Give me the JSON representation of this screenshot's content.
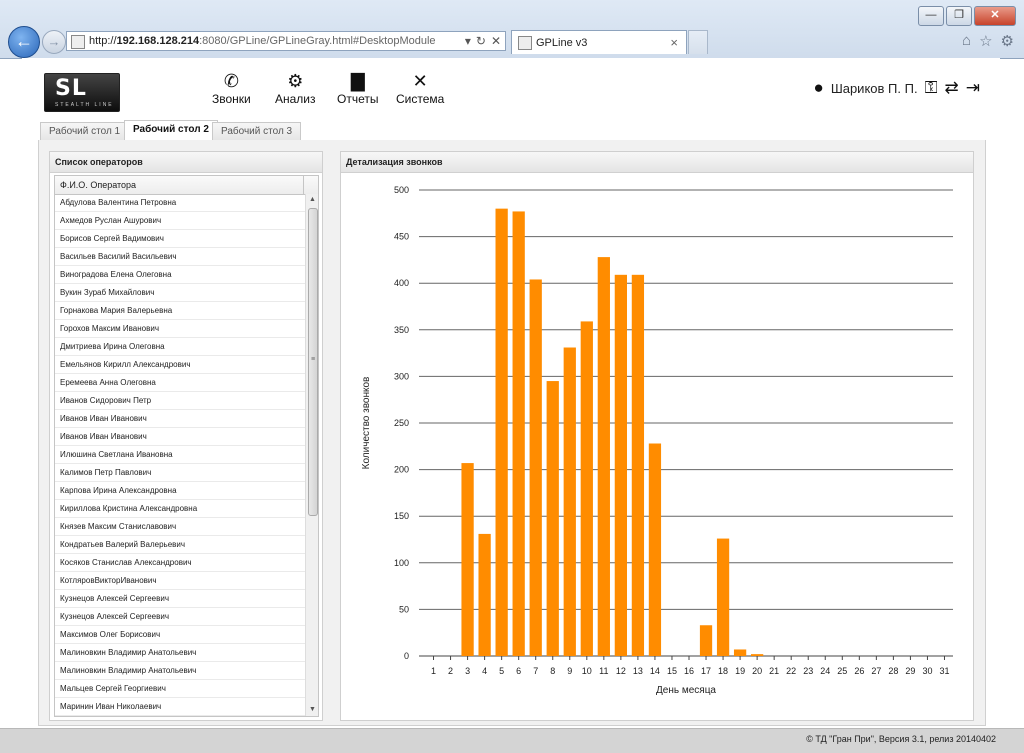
{
  "browser": {
    "url_prefix": "http://",
    "url_host": "192.168.128.214",
    "url_rest": ":8080/GPLine/GPLineGray.html#DesktopModule",
    "tab_title": "GPLine v3",
    "tab_close": "×",
    "back_glyph": "←",
    "forward_glyph": "→",
    "addr_icons": [
      "▾",
      "↻",
      "✕"
    ],
    "win_buttons": [
      "—",
      "❐",
      "✕"
    ],
    "toolbar_icons": [
      "⌂",
      "☆",
      "⚙"
    ]
  },
  "logo": {
    "mark": "SL",
    "sub": "STEALTH LINE"
  },
  "nav": [
    {
      "label": "Звонки",
      "icon": "phone-icon",
      "glyph": "✆"
    },
    {
      "label": "Анализ",
      "icon": "gears-icon",
      "glyph": "⚙"
    },
    {
      "label": "Отчеты",
      "icon": "bar-chart-icon",
      "glyph": "▇"
    },
    {
      "label": "Система",
      "icon": "tools-icon",
      "glyph": "✕"
    }
  ],
  "user": {
    "name": "Шариков П. П.",
    "user_glyph": "●",
    "key_glyph": "⚿",
    "swap_glyph": "⇄",
    "exit_glyph": "⇥"
  },
  "tabs": [
    "Рабочий стол 1",
    "Рабочий стол 2",
    "Рабочий стол 3"
  ],
  "active_tab_index": 1,
  "operators_panel": {
    "title": "Список операторов",
    "column_header": "Ф.И.О. Оператора",
    "grip": "≡",
    "up": "▲",
    "down": "▼",
    "rows": [
      "Абдулова Валентина Петровна",
      "Ахмедов Руслан Ашурович",
      "Борисов Сергей Вадимович",
      "Васильев Василий Васильевич",
      "Виноградова Елена Олеговна",
      "Вукин Зураб Михайлович",
      "Горнакова Мария Валерьевна",
      "Горохов Максим Иванович",
      "Дмитриева Ирина Олеговна",
      "Емельянов Кирилл Александрович",
      "Еремеева Анна Олеговна",
      "Иванов Сидорович Петр",
      "Иванов Иван Иванович",
      "Иванов Иван Иванович",
      "Илюшина Светлана Ивановна",
      "Калимов Петр Павлович",
      "Карпова Ирина Александровна",
      "Кириллова Кристина Александровна",
      "Князев Максим Станиславович",
      "Кондратьев Валерий Валерьевич",
      "Косяков Станислав Александрович",
      "КотляровВикторИванович",
      "Кузнецов Алексей Сергеевич",
      "Кузнецов Алексей Сергеевич",
      "Максимов Олег Борисович",
      "Малиновкин Владимир Анатольевич",
      "Малиновкин Владимир Анатольевич",
      "Мальцев Сергей Георгиевич",
      "Маринин Иван Николаевич"
    ]
  },
  "chart_panel": {
    "title": "Детализация звонков"
  },
  "chart_data": {
    "type": "bar",
    "xlabel": "День месяца",
    "ylabel": "Количество звонков",
    "ylim": [
      0,
      500
    ],
    "yticks": [
      0,
      50,
      100,
      150,
      200,
      250,
      300,
      350,
      400,
      450,
      500
    ],
    "grid": true,
    "bar_color": "#ff8c00",
    "categories": [
      "1",
      "2",
      "3",
      "4",
      "5",
      "6",
      "7",
      "8",
      "9",
      "10",
      "11",
      "12",
      "13",
      "14",
      "15",
      "16",
      "17",
      "18",
      "19",
      "20",
      "21",
      "22",
      "23",
      "24",
      "25",
      "26",
      "27",
      "28",
      "29",
      "30",
      "31"
    ],
    "values": [
      0,
      0,
      207,
      131,
      480,
      477,
      404,
      295,
      331,
      359,
      428,
      409,
      409,
      228,
      0,
      0,
      33,
      126,
      7,
      2,
      0,
      0,
      0,
      0,
      0,
      0,
      0,
      0,
      0,
      0,
      0
    ]
  },
  "footer": {
    "text": "© ТД \"Гран При\", Версия 3.1, релиз 20140402"
  }
}
